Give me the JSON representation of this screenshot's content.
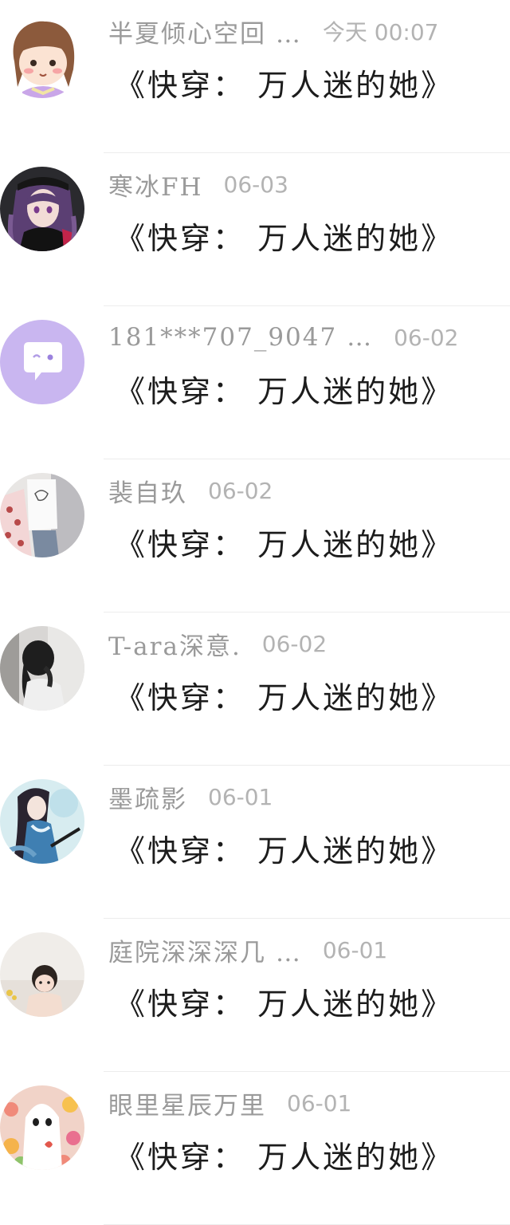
{
  "comments": [
    {
      "user": "半夏倾心空回 …",
      "time": "今天 00:07",
      "text": "《快穿： 万人迷的她》",
      "avatar": "cartoon-girl-avatar"
    },
    {
      "user": "寒冰FH",
      "time": "06-03",
      "text": "《快穿： 万人迷的她》",
      "avatar": "anime-girl-avatar"
    },
    {
      "user": "181***707_9047 …",
      "time": "06-02",
      "text": "《快穿： 万人迷的她》",
      "avatar": "default-chat-avatar"
    },
    {
      "user": "裴自玖",
      "time": "06-02",
      "text": "《快穿： 万人迷的她》",
      "avatar": "photo-avatar"
    },
    {
      "user": "T-ara深意.",
      "time": "06-02",
      "text": "《快穿： 万人迷的她》",
      "avatar": "photo-avatar"
    },
    {
      "user": "墨疏影",
      "time": "06-01",
      "text": "《快穿： 万人迷的她》",
      "avatar": "anime-swordsman-avatar"
    },
    {
      "user": "庭院深深深几 …",
      "time": "06-01",
      "text": "《快穿： 万人迷的她》",
      "avatar": "baby-photo-avatar"
    },
    {
      "user": "眼里星辰万里",
      "time": "06-01",
      "text": "《快穿： 万人迷的她》",
      "avatar": "ghost-flowers-avatar"
    }
  ],
  "colors": {
    "username": "#9a9a9a",
    "timestamp": "#b3b3b3",
    "comment_text": "#1c1c1c",
    "default_avatar_bg": "#c9b6f0"
  }
}
